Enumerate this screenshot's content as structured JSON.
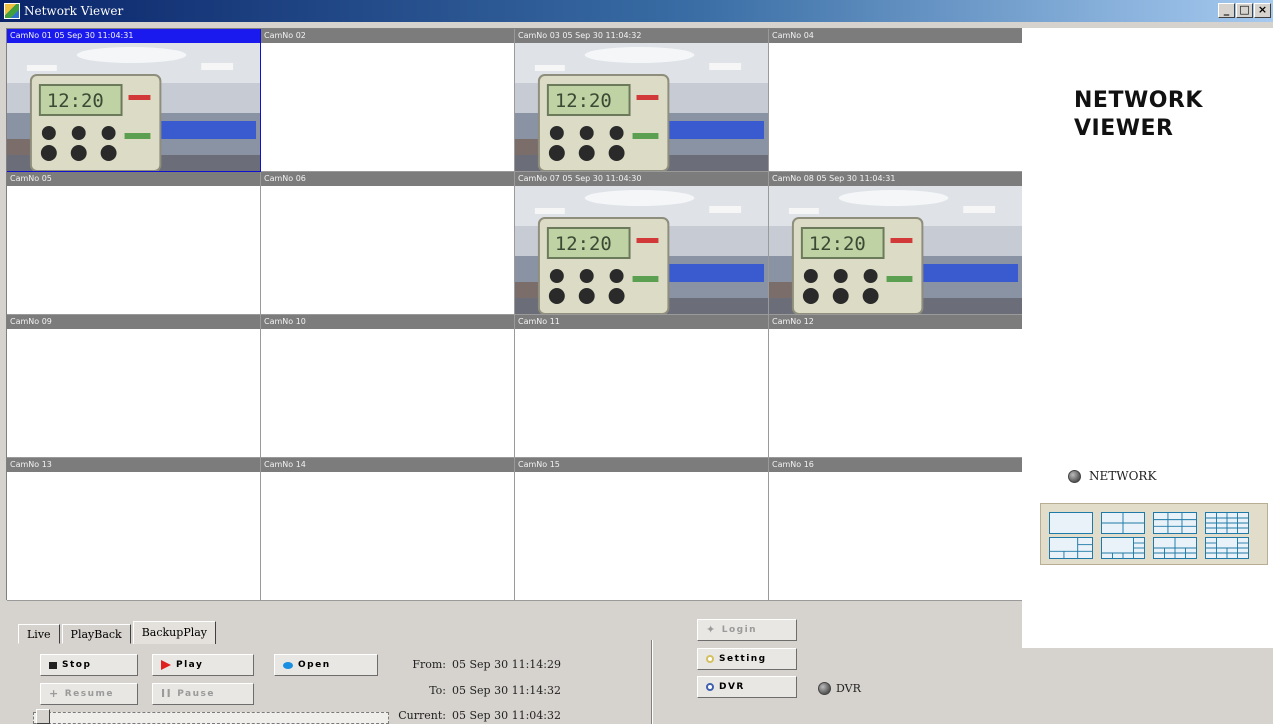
{
  "window": {
    "title": "Network Viewer",
    "minimize": "_",
    "maximize": "□",
    "close": "×"
  },
  "grid": {
    "cells": [
      {
        "label": "CamNo 01 05 Sep 30 11:04:31",
        "feed": true,
        "selected": true
      },
      {
        "label": "CamNo 02",
        "feed": false
      },
      {
        "label": "CamNo 03 05 Sep 30 11:04:32",
        "feed": true
      },
      {
        "label": "CamNo 04",
        "feed": false
      },
      {
        "label": "CamNo 05",
        "feed": false
      },
      {
        "label": "CamNo 06",
        "feed": false
      },
      {
        "label": "CamNo 07 05 Sep 30 11:04:30",
        "feed": true
      },
      {
        "label": "CamNo 08 05 Sep 30 11:04:31",
        "feed": true
      },
      {
        "label": "CamNo 09",
        "feed": false
      },
      {
        "label": "CamNo 10",
        "feed": false
      },
      {
        "label": "CamNo 11",
        "feed": false
      },
      {
        "label": "CamNo 12",
        "feed": false
      },
      {
        "label": "CamNo 13",
        "feed": false
      },
      {
        "label": "CamNo 14",
        "feed": false
      },
      {
        "label": "CamNo 15",
        "feed": false
      },
      {
        "label": "CamNo 16",
        "feed": false
      }
    ],
    "feed_clock_text": "12:20"
  },
  "brand": {
    "line1": "NETWORK",
    "line2": "VIEWER"
  },
  "network_indicator": {
    "label": "NETWORK"
  },
  "layouts": [
    "single",
    "quad",
    "nine",
    "sixteen",
    "six",
    "eight",
    "ten",
    "thirteen"
  ],
  "tabs": [
    {
      "label": "Live",
      "active": false
    },
    {
      "label": "PlayBack",
      "active": false
    },
    {
      "label": "BackupPlay",
      "active": true
    }
  ],
  "controls": {
    "stop": "Stop",
    "play": "Play",
    "open": "Open",
    "resume": "Resume",
    "pause": "Pause"
  },
  "times": {
    "from_label": "From:",
    "from_value": "05 Sep 30 11:14:29",
    "to_label": "To:",
    "to_value": "05 Sep 30 11:14:32",
    "current_label": "Current:",
    "current_value": "05 Sep 30 11:04:32"
  },
  "side_buttons": {
    "login": "Login",
    "setting": "Setting",
    "dvr": "DVR"
  },
  "dvr_indicator": {
    "label": "DVR"
  },
  "colors": {
    "selected_header": "#1a1aee",
    "cell_header": "#7c7c7c",
    "layout_icon_border": "#1f7aa8",
    "play_icon": "#e02020",
    "open_icon": "#1a8ee0"
  }
}
